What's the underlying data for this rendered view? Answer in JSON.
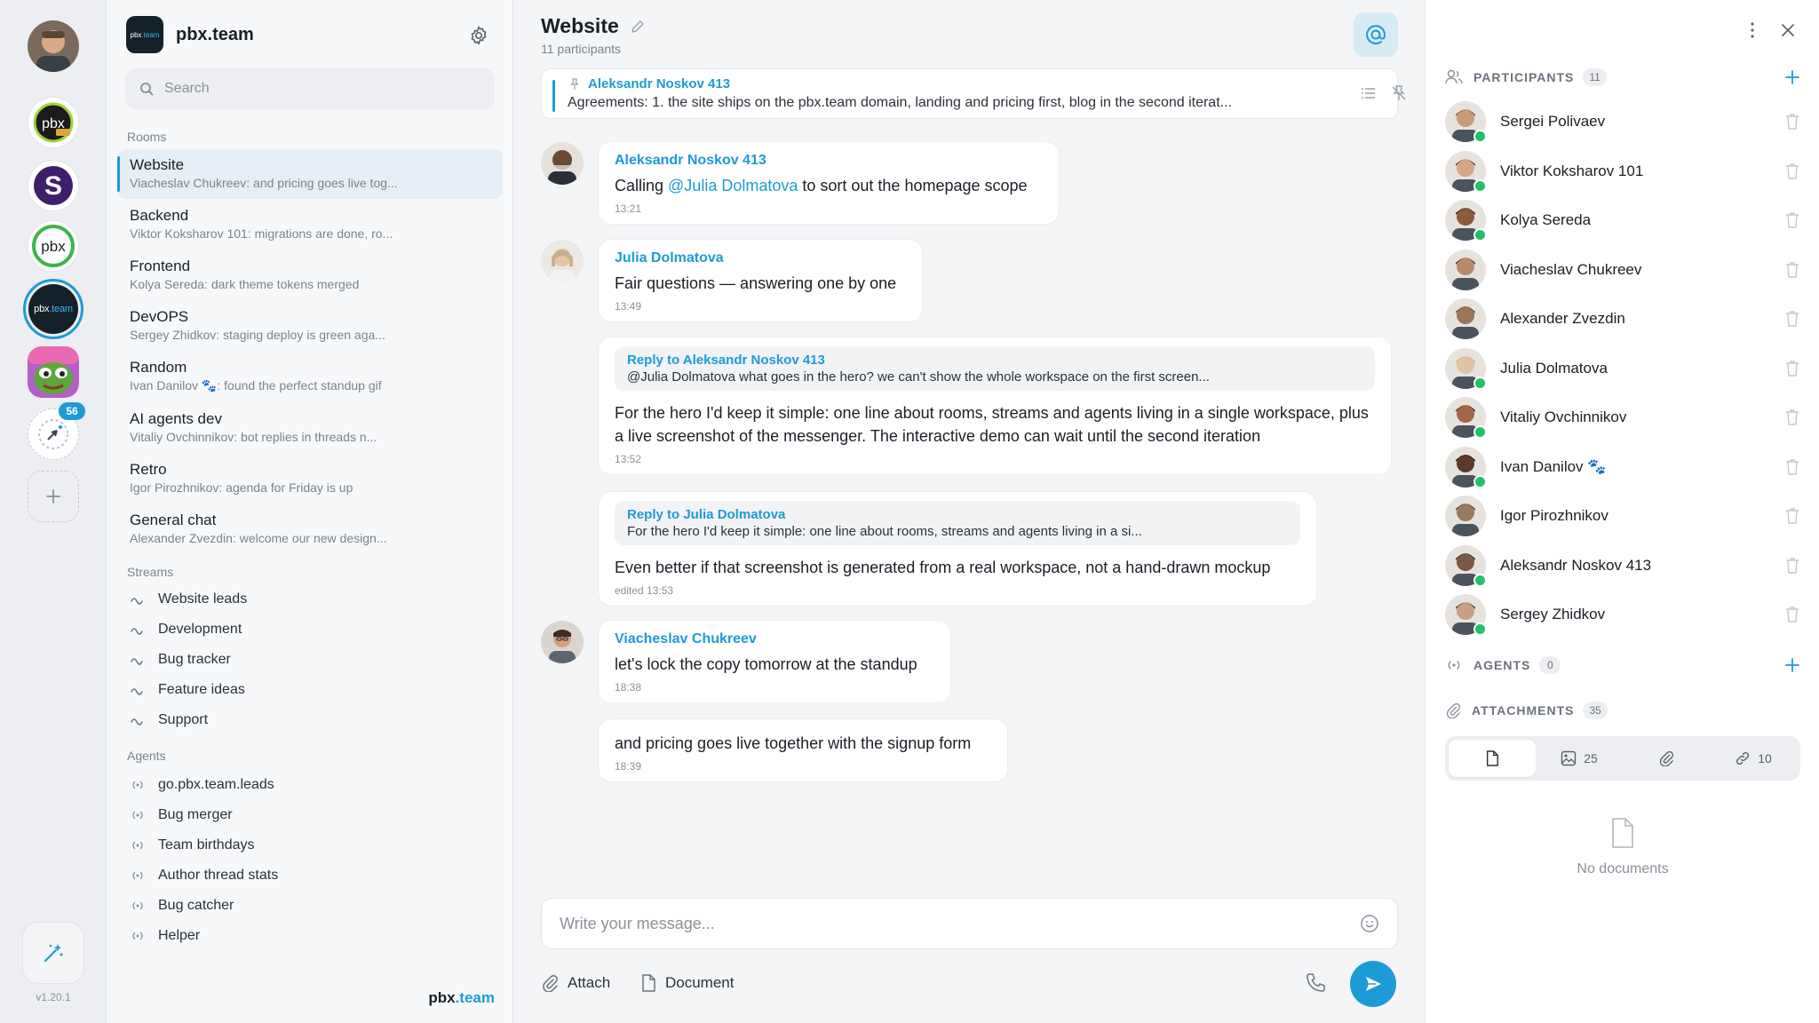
{
  "rail": {
    "badge_count": "56",
    "version": "v1.20.1",
    "workspace_pbx_label": "pbx",
    "workspace_s_label": "S",
    "workspace_pbxteam_prefix": "pbx",
    "workspace_pbxteam_suffix": ".team"
  },
  "sidebar": {
    "brand_name": "pbx.team",
    "brand_logo_prefix": "pbx",
    "brand_logo_suffix": ".team",
    "search_placeholder": "Search",
    "rooms_label": "Rooms",
    "rooms": [
      {
        "name": "Website",
        "preview": "Viacheslav Chukreev: and pricing goes live tog..."
      },
      {
        "name": "Backend",
        "preview": "Viktor Koksharov 101: migrations are done, ro..."
      },
      {
        "name": "Frontend",
        "preview": "Kolya Sereda: dark theme tokens merged"
      },
      {
        "name": "DevOPS",
        "preview": "Sergey Zhidkov: staging deploy is green aga..."
      },
      {
        "name": "Random",
        "preview": "Ivan Danilov 🐾: found the perfect standup gif"
      },
      {
        "name": "AI agents dev",
        "preview": "Vitaliy Ovchinnikov: bot replies in threads n..."
      },
      {
        "name": "Retro",
        "preview": "Igor Pirozhnikov: agenda for Friday is up"
      },
      {
        "name": "General chat",
        "preview": "Alexander Zvezdin: welcome our new design..."
      }
    ],
    "streams_label": "Streams",
    "streams": [
      "Website leads",
      "Development",
      "Bug tracker",
      "Feature ideas",
      "Support"
    ],
    "agents_label": "Agents",
    "agents": [
      "go.pbx.team.leads",
      "Bug merger",
      "Team birthdays",
      "Author thread stats",
      "Bug catcher",
      "Helper"
    ],
    "footer_prefix": "pbx",
    "footer_suffix": ".team"
  },
  "chat": {
    "title": "Website",
    "participants": "11 participants",
    "pinned": {
      "author": "Aleksandr Noskov 413",
      "text": "Agreements: 1. the site ships on the pbx.team domain, landing and pricing first, blog in the second iterat..."
    },
    "messages": [
      {
        "author": "Aleksandr Noskov 413",
        "before": "Calling ",
        "mention": "@Julia Dolmatova",
        "after": " to sort out the homepage scope",
        "time": "13:21"
      },
      {
        "author": "Julia Dolmatova",
        "body": "Fair questions — answering one by one",
        "time": "13:49"
      },
      {
        "reply_label": "Reply to Aleksandr Noskov 413",
        "reply_text": "@Julia Dolmatova what goes in the hero? we can't show the whole workspace on the first screen...",
        "body": "For the hero I'd keep it simple: one line about rooms, streams and agents living in a single workspace, plus a live screenshot of the messenger. The interactive demo can wait until the second iteration",
        "time": "13:52"
      },
      {
        "reply_label": "Reply to Julia Dolmatova",
        "reply_text": "For the hero I'd keep it simple: one line about rooms, streams and agents living in a si...",
        "body": "Even better if that screenshot is generated from a real workspace, not a hand-drawn mockup",
        "time": "edited 13:53"
      },
      {
        "author": "Viacheslav Chukreev",
        "body": "let's lock the copy tomorrow at the standup",
        "time": "18:38"
      },
      {
        "body": "and pricing goes live together with the signup form",
        "time": "18:39"
      }
    ],
    "composer_placeholder": "Write your message...",
    "attach_label": "Attach",
    "document_label": "Document"
  },
  "panel": {
    "participants_label": "PARTICIPANTS",
    "participants_count": "11",
    "people": [
      {
        "name": "Sergei Polivaev",
        "online": true
      },
      {
        "name": "Viktor Koksharov 101",
        "online": true
      },
      {
        "name": "Kolya Sereda",
        "online": true
      },
      {
        "name": "Viacheslav Chukreev",
        "online": false
      },
      {
        "name": "Alexander Zvezdin",
        "online": false
      },
      {
        "name": "Julia Dolmatova",
        "online": true
      },
      {
        "name": "Vitaliy Ovchinnikov",
        "online": true
      },
      {
        "name": "Ivan Danilov 🐾",
        "online": true
      },
      {
        "name": "Igor Pirozhnikov",
        "online": false
      },
      {
        "name": "Aleksandr Noskov 413",
        "online": true
      },
      {
        "name": "Sergey Zhidkov",
        "online": true
      }
    ],
    "agents_label": "AGENTS",
    "agents_count": "0",
    "attachments_label": "ATTACHMENTS",
    "attachments_count": "35",
    "tabs": {
      "images": "25",
      "links": "10"
    },
    "empty_text": "No documents"
  },
  "colors": {
    "accent": "#1d9bd6",
    "online": "#22c06a"
  }
}
